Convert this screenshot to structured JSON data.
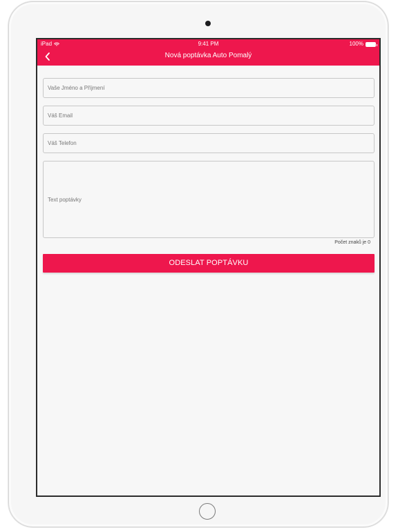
{
  "status_bar": {
    "carrier": "iPad",
    "wifi_icon": "wifi-icon",
    "time": "9:41 PM",
    "battery": "100%",
    "battery_icon": "battery-icon"
  },
  "nav": {
    "title": "Nová poptávka Auto Pomalý",
    "back_icon": "chevron-left-icon"
  },
  "form": {
    "name_placeholder": "Vaše Jméno a Příjmení",
    "email_placeholder": "Váš Email",
    "phone_placeholder": "Váš Telefon",
    "message_placeholder": "Text poptávky",
    "counter": "Počet znaků je 0",
    "submit_label": "ODESLAT POPTÁVKU"
  },
  "colors": {
    "accent": "#ee174d",
    "screen_background": "#f7f7f7",
    "field_border": "#c7c7c7"
  }
}
